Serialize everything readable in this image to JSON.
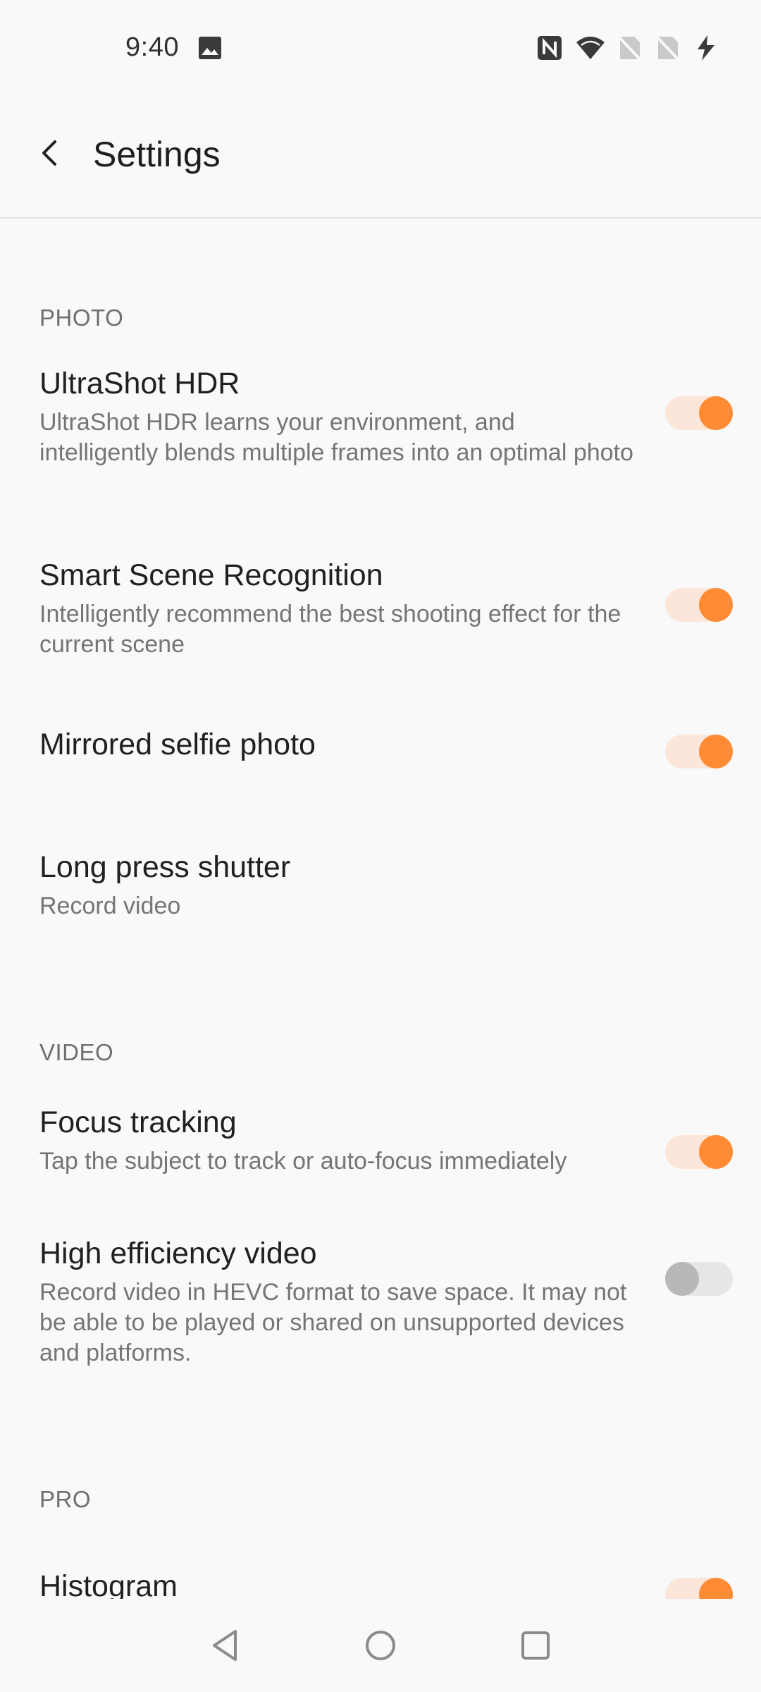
{
  "status_bar": {
    "time": "9:40",
    "icons": [
      "image-icon",
      "nfc-icon",
      "wifi-icon",
      "no-sim-icon",
      "no-sim-icon",
      "charging-icon"
    ]
  },
  "app_bar": {
    "title": "Settings",
    "back_icon": "back-arrow-icon"
  },
  "sections": {
    "photo": {
      "header": "PHOTO",
      "items": [
        {
          "title": "UltraShot HDR",
          "description": "UltraShot HDR learns your environment, and intelligently blends multiple frames into an optimal photo",
          "enabled": true
        },
        {
          "title": "Smart Scene Recognition",
          "description": "Intelligently recommend the best shooting effect for the current scene",
          "enabled": true
        },
        {
          "title": "Mirrored selfie photo",
          "enabled": true
        },
        {
          "title": "Long press shutter",
          "description": "Record video"
        }
      ]
    },
    "video": {
      "header": "VIDEO",
      "items": [
        {
          "title": "Focus tracking",
          "description": "Tap the subject to track or auto-focus immediately",
          "enabled": true
        },
        {
          "title": "High efficiency video",
          "description": "Record video in HEVC format to save space. It may not be able to be played or shared on unsupported devices and platforms.",
          "enabled": false
        }
      ]
    },
    "pro": {
      "header": "PRO",
      "items": [
        {
          "title": "Histogram",
          "enabled": true
        }
      ]
    }
  },
  "colors": {
    "accent": "#ff8c35",
    "accent_track": "#fce6da",
    "toggle_off_thumb": "#b8b8b8",
    "toggle_off_track": "#e6e6e6",
    "background": "#f9f9f9"
  },
  "nav_bar": {
    "icons": [
      "back-triangle-icon",
      "home-circle-icon",
      "recents-square-icon"
    ]
  }
}
